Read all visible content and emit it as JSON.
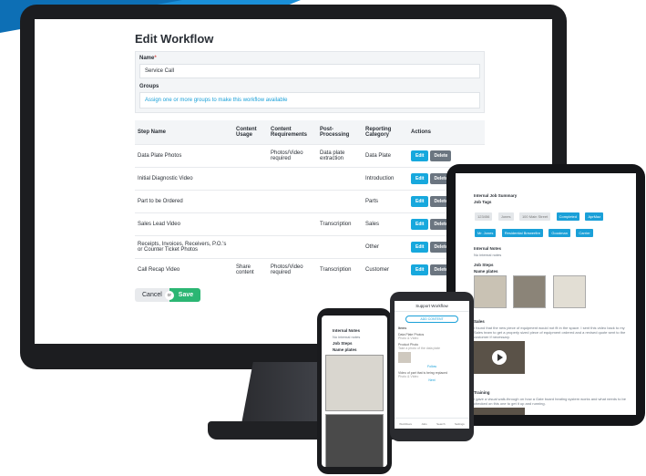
{
  "workflow": {
    "title": "Edit Workflow",
    "name_label": "Name",
    "required_mark": "*",
    "name_value": "Service Call",
    "groups_label": "Groups",
    "groups_placeholder": "Assign one or more groups to make this workflow available",
    "columns": [
      "Step Name",
      "Content Usage",
      "Content Requirements",
      "Post-Processing",
      "Reporting Category",
      "Actions"
    ],
    "rows": [
      {
        "step": "Data Plate Photos",
        "usage": "",
        "req": "Photos/Video required",
        "post": "Data plate extraction",
        "cat": "Data Plate"
      },
      {
        "step": "Initial Diagnostic Video",
        "usage": "",
        "req": "",
        "post": "",
        "cat": "Introduction"
      },
      {
        "step": "Part to be Ordered",
        "usage": "",
        "req": "",
        "post": "",
        "cat": "Parts"
      },
      {
        "step": "Sales Lead Video",
        "usage": "",
        "req": "",
        "post": "Transcription",
        "cat": "Sales"
      },
      {
        "step": "Receipts, Invoices, Receivers, P.O.'s or Counter Ticket Photos",
        "usage": "",
        "req": "",
        "post": "",
        "cat": "Other"
      },
      {
        "step": "Call Recap Video",
        "usage": "Share content",
        "req": "Photos/Video required",
        "post": "Transcription",
        "cat": "Customer"
      }
    ],
    "edit_label": "Edit",
    "delete_label": "Delete",
    "cancel_label": "Cancel",
    "or_label": "or",
    "save_label": "Save"
  },
  "tablet": {
    "summary_title": "Internal Job Summary",
    "job_tags_label": "Job Tags",
    "tags_gray": [
      "123456",
      "Jones",
      "100 Main Street"
    ],
    "tags_blue": [
      "Completed",
      "AprMaz",
      "Mr. Jones",
      "Residential Brewerfire",
      "Goodman",
      "Carrier"
    ],
    "internal_notes_label": "Internal Notes",
    "internal_notes_value": "No internal notes",
    "job_steps_label": "Job Steps",
    "name_plates_label": "Name plates",
    "sales_label": "Sales",
    "sales_text": "I found that the new piece of equipment would not fit in the space. I sent this video back to my Sales team to get a properly sized piece of equipment ordered and a revised quote sent to the customer if necessary.",
    "training_label": "Training",
    "training_text": "I gave a visual walk-through on how a Gate board heating system works and what needs to be checked on this one to get it up and running."
  },
  "phone1": {
    "internal_notes": "Internal Notes",
    "notes_value": "No internal notes",
    "job_steps": "Job Steps",
    "name_plates": "Name plates"
  },
  "phone2": {
    "header": "Support Workflow",
    "add_content": "ADD CONTENT",
    "items_label": "Items",
    "item1_title": "Data Plate Photos",
    "item1_sub": "Photo & Video",
    "item2_title": "Product Photo",
    "item2_sub": "Take a photo of the data plate",
    "link1": "Follow",
    "item3_title": "Video of part that is being replaced",
    "item3_sub": "Photo & Video",
    "link2": "Next",
    "nav": [
      "Workflows",
      "Jobs",
      "Search",
      "Settings"
    ]
  }
}
